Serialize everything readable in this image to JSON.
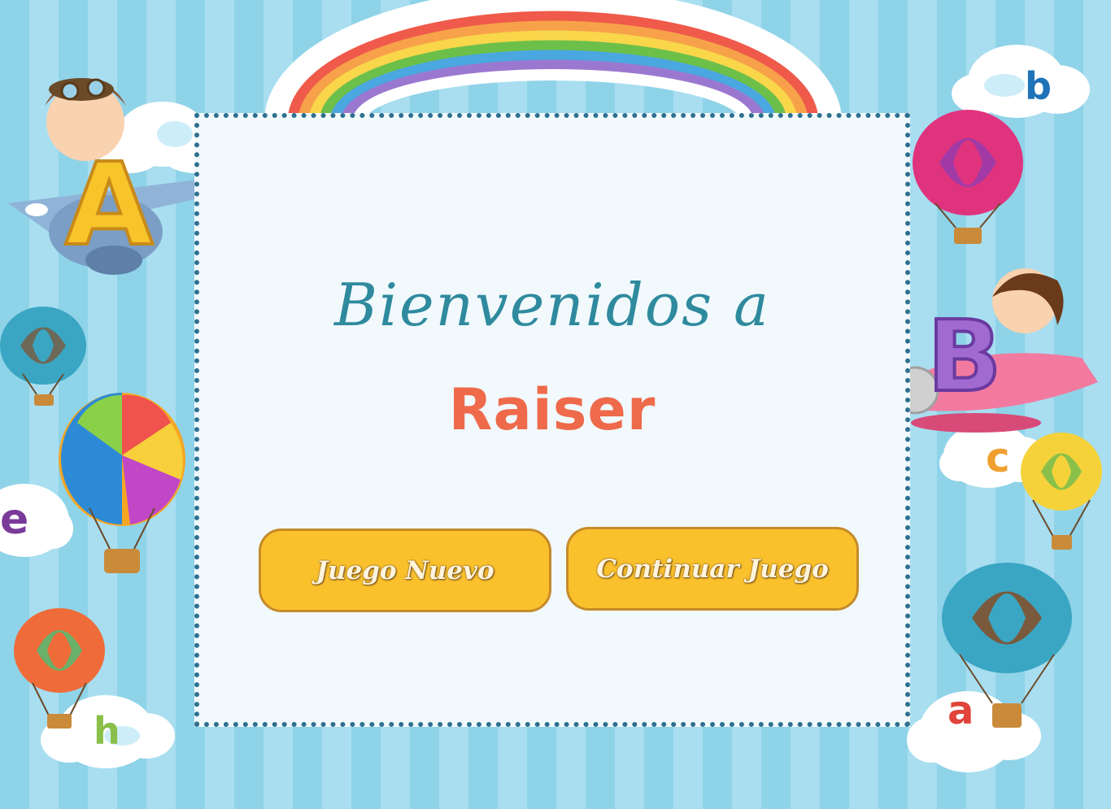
{
  "welcome": {
    "line1": "Bienvenidos a",
    "line2": "Raiser"
  },
  "buttons": {
    "new_game": "Juego Nuevo",
    "continue_game": "Continuar Juego"
  },
  "decorations": {
    "letters": [
      "b",
      "e",
      "c",
      "h",
      "a"
    ],
    "plane_letters": [
      "A",
      "B"
    ]
  },
  "colors": {
    "background_stripe_a": "#8fd3e8",
    "background_stripe_b": "#a8def0",
    "card_background": "#f1f9fc",
    "card_border": "#2f6f8f",
    "title_teal": "#2f8a9e",
    "title_orange": "#ee6a4b",
    "button_fill": "#fbc12d",
    "button_border": "#c58b2a"
  }
}
